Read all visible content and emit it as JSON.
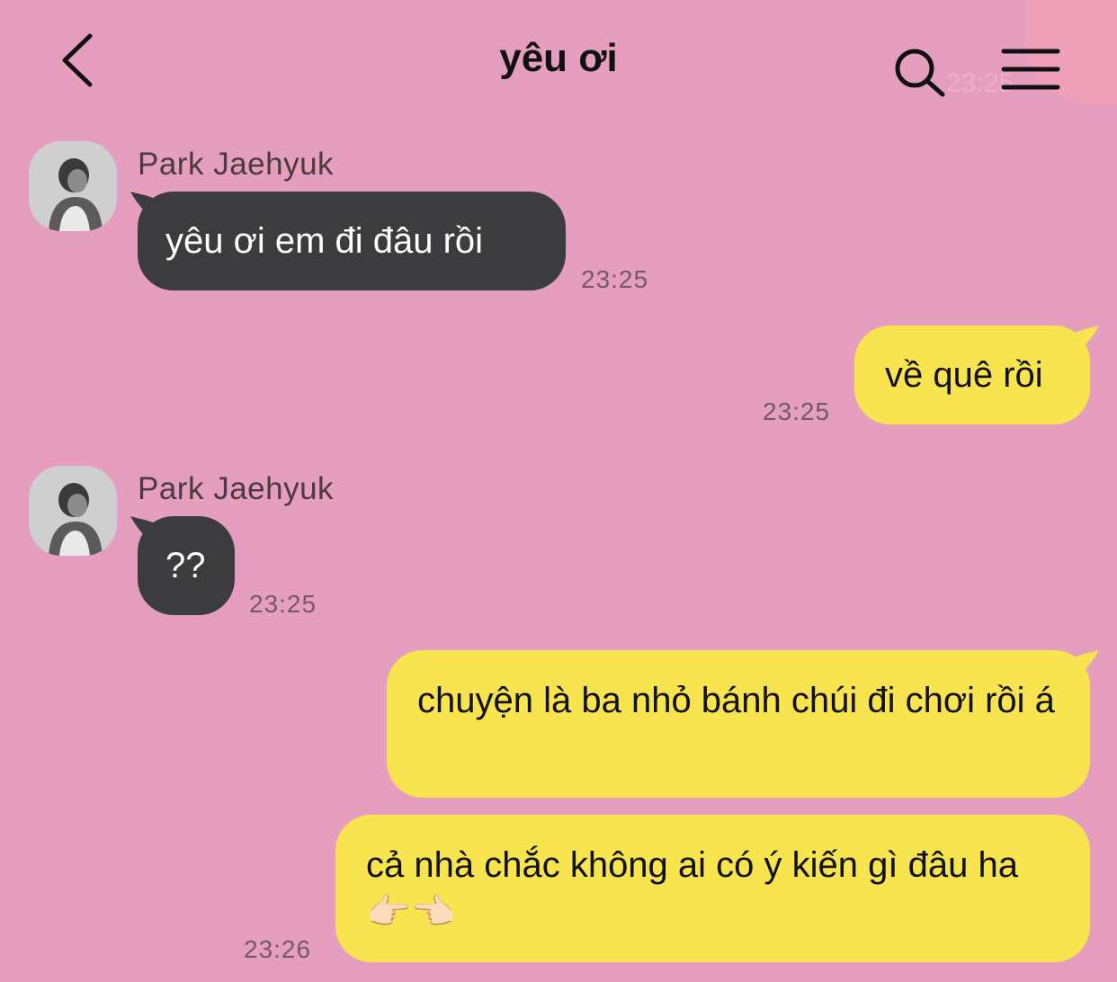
{
  "header": {
    "title": "yêu ơi",
    "ghost_time": "23:25"
  },
  "messages": [
    {
      "sender": "Park Jaehyuk",
      "text": "yêu ơi em đi đâu rồi",
      "time": "23:25",
      "direction": "incoming"
    },
    {
      "text": "về quê rồi",
      "time": "23:25",
      "direction": "outgoing"
    },
    {
      "sender": "Park Jaehyuk",
      "text": "??",
      "time": "23:25",
      "direction": "incoming"
    },
    {
      "text": "chuyện là ba nhỏ bánh chúi đi chơi rồi á",
      "direction": "outgoing"
    },
    {
      "text": "cả nhà chắc không ai có ý kiến gì đâu ha 👉🏻👈🏻",
      "time": "23:26",
      "direction": "outgoing"
    }
  ],
  "colors": {
    "background": "#E69EBF",
    "incoming_bubble": "#3C3B3D",
    "outgoing_bubble": "#F8E44F"
  },
  "icons": [
    "back-chevron-icon",
    "search-icon",
    "menu-icon"
  ]
}
